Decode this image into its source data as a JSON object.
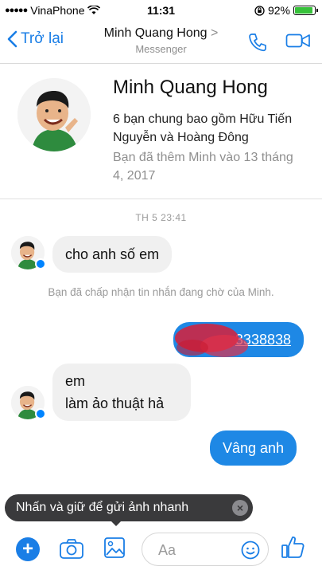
{
  "status_bar": {
    "carrier": "VinaPhone",
    "time": "11:31",
    "battery": "92%"
  },
  "nav": {
    "back_label": "Trở lại",
    "title": "Minh Quang Hong",
    "chevron": ">",
    "subtitle": "Messenger"
  },
  "contact": {
    "name": "Minh Quang Hong",
    "mutual": "6 bạn chung bao gồm Hữu Tiến Nguyễn và Hoàng Đông",
    "added": "Bạn đã thêm Minh vào 13 tháng 4, 2017"
  },
  "conversation": {
    "timestamp": "TH 5 23:41",
    "msg1": "cho anh số em",
    "system_note": "Bạn đã chấp nhận tin nhắn đang chờ của Minh.",
    "phone_visible": "3338838",
    "msg3_line1": "em",
    "msg3_line2": "làm ảo thuật hả",
    "msg4": "Vâng anh"
  },
  "tooltip": {
    "text": "Nhấn và giữ để gửi ảnh nhanh",
    "close": "×"
  },
  "composer": {
    "plus": "+",
    "placeholder": "Aa"
  },
  "colors": {
    "accent": "#1a7ee6",
    "bubble_out": "#1e88e5",
    "bubble_in": "#f0f0f0"
  },
  "icons": [
    "signal-dots-icon",
    "wifi-icon",
    "lock-rotation-icon",
    "battery-icon",
    "back-chevron-icon",
    "phone-icon",
    "video-icon",
    "messenger-badge-icon",
    "camera-icon",
    "image-icon",
    "emoji-icon",
    "like-icon",
    "close-icon"
  ]
}
